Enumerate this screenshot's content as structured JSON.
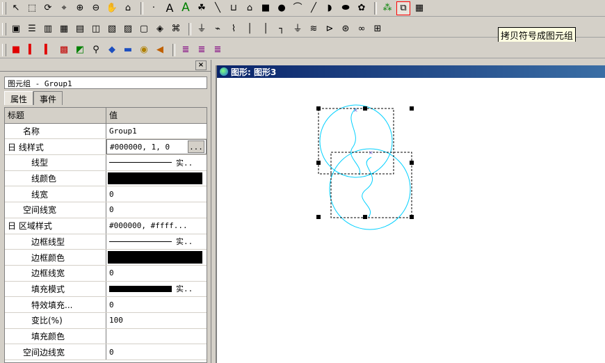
{
  "toolbar1": {
    "icons": [
      "pointer",
      "select-box",
      "rotate",
      "node",
      "zoom-in",
      "zoom-out",
      "pan",
      "polygon",
      "dot",
      "text-A",
      "text-A-large",
      "sprite",
      "line",
      "shape-u",
      "house",
      "square",
      "circle",
      "arc",
      "slash",
      "semicircle",
      "ellipse",
      "flower",
      "group",
      "copy-symbol",
      "table"
    ]
  },
  "toolbar2": {
    "icons": [
      "image",
      "stack",
      "bars",
      "grid",
      "chart",
      "dialog",
      "table",
      "list",
      "globe",
      "pin",
      "capacitor",
      "resistor",
      "wire1",
      "wire2",
      "ground",
      "coil",
      "transistor",
      "motor",
      "component"
    ]
  },
  "toolbar3": {
    "icons": [
      "red-square",
      "red-bar",
      "red-bar2",
      "pattern",
      "green",
      "search",
      "book",
      "monitor",
      "clock",
      "arrow",
      "page1",
      "page2",
      "page3"
    ]
  },
  "tooltip": "拷贝符号成图元组",
  "panel": {
    "object_selector": "图元组 - Group1",
    "tabs": [
      {
        "label": "属性"
      },
      {
        "label": "事件"
      }
    ],
    "grid_header": {
      "name": "标题",
      "value": "值"
    },
    "rows": [
      {
        "name": "名称",
        "value": "Group1"
      },
      {
        "name": "日 线样式",
        "value": "#000000, 1, 0"
      },
      {
        "name": "线型",
        "value": "实.."
      },
      {
        "name": "线颜色",
        "value": ""
      },
      {
        "name": "线宽",
        "value": "0"
      },
      {
        "name": "空间线宽",
        "value": "0"
      },
      {
        "name": "日 区域样式",
        "value": "#000000, #ffff..."
      },
      {
        "name": "边框线型",
        "value": "实.."
      },
      {
        "name": "边框颜色",
        "value": ""
      },
      {
        "name": "边框线宽",
        "value": "0"
      },
      {
        "name": "填充模式",
        "value": "实.."
      },
      {
        "name": "特效填充...",
        "value": "0"
      },
      {
        "name": "变比(%)",
        "value": "100"
      },
      {
        "name": "填充颜色",
        "value": ""
      },
      {
        "name": "空间边线宽",
        "value": "0"
      }
    ],
    "ellipsis": "..."
  },
  "canvas": {
    "title": "图形: 图形3"
  },
  "colors": {
    "accent": "#00d0ff",
    "titlebar": "#0a246a"
  }
}
